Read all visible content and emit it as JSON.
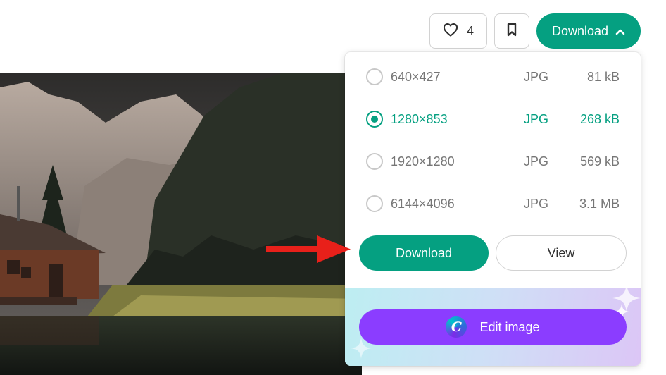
{
  "toolbar": {
    "like_count": "4",
    "download_label": "Download",
    "icons": {
      "like": "heart-icon",
      "bookmark": "bookmark-icon",
      "expand": "chevron-up-icon"
    }
  },
  "download_menu": {
    "sizes": [
      {
        "dims": "640×427",
        "format": "JPG",
        "size": "81 kB",
        "selected": false
      },
      {
        "dims": "1280×853",
        "format": "JPG",
        "size": "268 kB",
        "selected": true
      },
      {
        "dims": "1920×1280",
        "format": "JPG",
        "size": "569 kB",
        "selected": false
      },
      {
        "dims": "6144×4096",
        "format": "JPG",
        "size": "3.1 MB",
        "selected": false
      }
    ],
    "download_label": "Download",
    "view_label": "View",
    "edit_label": "Edit image",
    "edit_logo_letter": "C"
  },
  "colors": {
    "accent": "#05a081",
    "canva_purple": "#8b3dff",
    "annotation_arrow": "#e8201a"
  }
}
